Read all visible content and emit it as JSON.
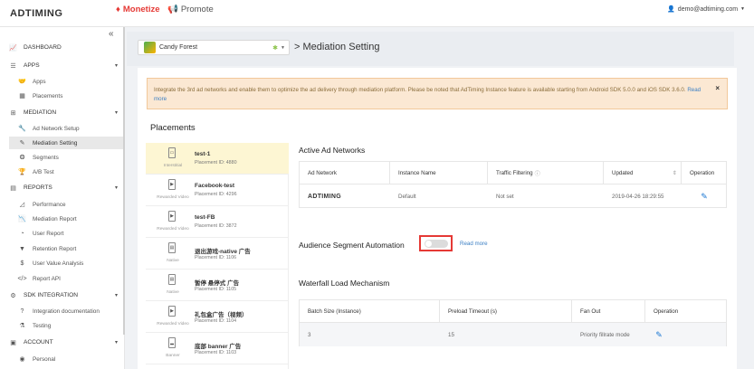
{
  "topbar": {
    "logo": "ADTIMING",
    "nav_monetize": "Monetize",
    "nav_promote": "Promote",
    "user_email": "demo@adtiming.com"
  },
  "sidebar": {
    "sections": [
      {
        "label": "DASHBOARD",
        "icon": "chart-line-icon"
      },
      {
        "label": "APPS",
        "icon": "list-icon"
      },
      {
        "label": "MEDIATION",
        "icon": "sitemap-icon"
      },
      {
        "label": "REPORTS",
        "icon": "table-icon"
      },
      {
        "label": "SDK INTEGRATION",
        "icon": "cogs-icon"
      },
      {
        "label": "ACCOUNT",
        "icon": "id-card-icon"
      }
    ],
    "items": [
      {
        "label": "Apps",
        "icon": "handshake-icon"
      },
      {
        "label": "Placements",
        "icon": "grid-icon"
      },
      {
        "label": "Ad Network Setup",
        "icon": "wrench-icon"
      },
      {
        "label": "Mediation Setting",
        "icon": "edit-icon"
      },
      {
        "label": "Segments",
        "icon": "segments-icon"
      },
      {
        "label": "A/B Test",
        "icon": "trophy-icon"
      },
      {
        "label": "Performance",
        "icon": "area-chart-icon"
      },
      {
        "label": "Mediation Report",
        "icon": "line-chart-icon"
      },
      {
        "label": "User Report",
        "icon": "pie-chart-icon"
      },
      {
        "label": "Retention Report",
        "icon": "filter-icon"
      },
      {
        "label": "User Value Analysis",
        "icon": "dollar-icon"
      },
      {
        "label": "Report API",
        "icon": "code-icon"
      },
      {
        "label": "Integration documentation",
        "icon": "help-icon"
      },
      {
        "label": "Testing",
        "icon": "testing-icon"
      },
      {
        "label": "Personal",
        "icon": "user-circle-icon"
      }
    ]
  },
  "header": {
    "app_name": "Candy Forest",
    "page_title": "> Mediation Setting"
  },
  "alert": {
    "text": "Integrate the 3rd ad networks and enable them to optimize the ad delivery through mediation platform. Please be noted that AdTiming Instance feature is available starting from Android SDK 5.0.0 and iOS SDK 3.6.0.",
    "link": "Read more",
    "close": "×"
  },
  "placements": {
    "title": "Placements",
    "items": [
      {
        "name": "test-1",
        "id": "Placement ID: 4880",
        "type": "Interstitial"
      },
      {
        "name": "Facebook-test",
        "id": "Placement ID: 4296",
        "type": "Rewarded Video"
      },
      {
        "name": "test-FB",
        "id": "Placement ID: 3872",
        "type": "Rewarded Video"
      },
      {
        "name": "退出游戏-native 广告",
        "id": "Placement ID: 1106",
        "type": "Native"
      },
      {
        "name": "暂停 悬停式 广告",
        "id": "Placement ID: 1105",
        "type": "Native"
      },
      {
        "name": "礼包盒广告（视频）",
        "id": "Placement ID: 1104",
        "type": "Rewarded Video"
      },
      {
        "name": "底部 banner 广告",
        "id": "Placement ID: 1103",
        "type": "Banner"
      }
    ]
  },
  "active_networks": {
    "title": "Active Ad Networks",
    "columns": [
      "Ad Network",
      "Instance Name",
      "Traffic Filtering",
      "Updated",
      "Operation"
    ],
    "rows": [
      {
        "network": "ADTIMING",
        "instance": "Default",
        "filtering": "Not set",
        "updated": "2019-04-26 18:29:55"
      }
    ]
  },
  "segment": {
    "title": "Audience Segment Automation",
    "enabled": false,
    "link": "Read more"
  },
  "waterfall": {
    "title": "Waterfall Load Mechanism",
    "columns": [
      "Batch Size (Instance)",
      "Preload Timeout (s)",
      "Fan Out",
      "Operation"
    ],
    "rows": [
      {
        "batch": "3",
        "timeout": "15",
        "fanout": "Priority fillrate mode"
      }
    ]
  },
  "colors": {
    "brand": "#e53935",
    "link": "#3b7fc4",
    "alert_bg": "#fbe8d3",
    "active_row": "#fdf6d3"
  }
}
